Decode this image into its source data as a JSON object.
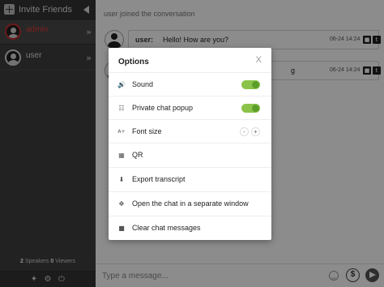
{
  "sidebar": {
    "invite_label": "Invite Friends",
    "users": [
      {
        "name": "admin",
        "role": "admin"
      },
      {
        "name": "user",
        "role": "user"
      }
    ],
    "stats": {
      "speakers_count": "2",
      "speakers_label": "Speakers",
      "viewers_count": "0",
      "viewers_label": "Viewers"
    }
  },
  "chat": {
    "system_message": "user joined the conversation",
    "messages": [
      {
        "author": "user:",
        "text": "Hello! How are you?",
        "time": "06-24 14:24"
      },
      {
        "author": "",
        "text": "g",
        "time": "06-24 14:24"
      }
    ],
    "composer_placeholder": "Type a message..."
  },
  "modal": {
    "title": "Options",
    "close": "X",
    "options": [
      {
        "label": "Sound",
        "icon": "speaker-icon",
        "control": "toggle",
        "value": true
      },
      {
        "label": "Private chat popup",
        "icon": "popup-icon",
        "control": "toggle",
        "value": true
      },
      {
        "label": "Font size",
        "icon": "font-size-icon",
        "control": "stepper"
      },
      {
        "label": "QR",
        "icon": "qr-icon"
      },
      {
        "label": "Export transcript",
        "icon": "export-icon"
      },
      {
        "label": "Open the chat in a separate window",
        "icon": "move-icon"
      },
      {
        "label": "Clear chat messages",
        "icon": "trash-icon"
      }
    ],
    "font_minus": "-",
    "font_plus": "+"
  },
  "colors": {
    "sidebar_bg": "#3e3e3e",
    "admin_name": "#e23b3b",
    "toggle_on": "#8bc34a",
    "overlay": "rgba(0,0,0,0.45)"
  }
}
